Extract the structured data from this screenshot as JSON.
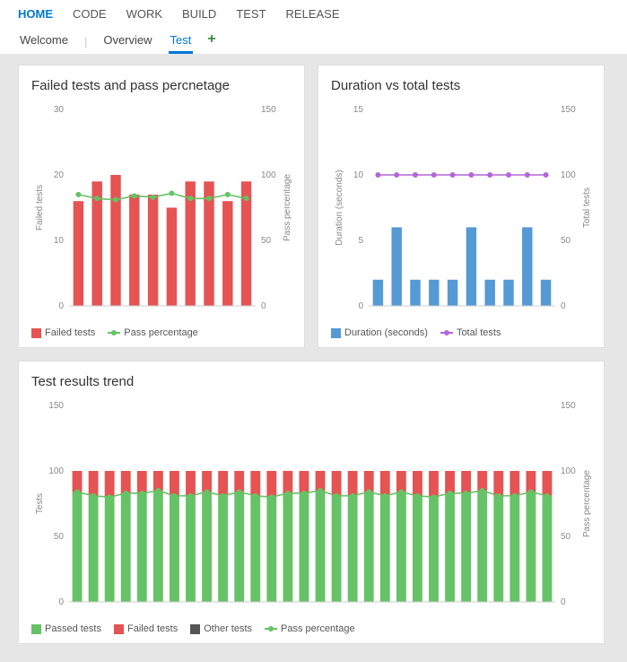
{
  "nav": {
    "main": [
      "HOME",
      "CODE",
      "WORK",
      "BUILD",
      "TEST",
      "RELEASE"
    ],
    "main_active": 0,
    "sub": [
      "Welcome",
      "Overview",
      "Test"
    ],
    "sub_active": 2
  },
  "colors": {
    "blue": "#0078d4",
    "red": "#e55353",
    "green": "#66c266",
    "purple": "#b366d9",
    "barBlue": "#5599d5",
    "grey": "#888888",
    "darkGrey": "#555555"
  },
  "chart_data": [
    {
      "id": "failed",
      "type": "bar+line",
      "title": "Failed tests and pass percnetage",
      "xcount": 10,
      "ylabel_left": "Failed tests",
      "ylabel_right": "Pass percentage",
      "ylim_left": [
        0,
        30
      ],
      "ylim_right": [
        0,
        150
      ],
      "ticks_left": [
        0,
        10,
        20,
        30
      ],
      "ticks_right": [
        0,
        50,
        100,
        150
      ],
      "series": [
        {
          "name": "Failed tests",
          "kind": "bar",
          "axis": "left",
          "color": "#e55353",
          "values": [
            16,
            19,
            20,
            17,
            17,
            15,
            19,
            19,
            16,
            19
          ]
        },
        {
          "name": "Pass percentage",
          "kind": "line",
          "axis": "right",
          "color": "#66c266",
          "values": [
            85,
            82,
            81,
            84,
            83,
            86,
            82,
            82,
            85,
            82
          ]
        }
      ],
      "legend": [
        {
          "swatch": "#e55353",
          "shape": "box",
          "label": "Failed tests"
        },
        {
          "swatch": "#66c266",
          "shape": "line",
          "label": "Pass percentage"
        }
      ]
    },
    {
      "id": "duration",
      "type": "bar+line",
      "title": "Duration vs total tests",
      "xcount": 10,
      "ylabel_left": "Duration (seconds)",
      "ylabel_right": "Total tests",
      "ylim_left": [
        0,
        15
      ],
      "ylim_right": [
        0,
        150
      ],
      "ticks_left": [
        0,
        5,
        10,
        15
      ],
      "ticks_right": [
        0,
        50,
        100,
        150
      ],
      "series": [
        {
          "name": "Duration (seconds)",
          "kind": "bar",
          "axis": "left",
          "color": "#5599d5",
          "values": [
            2,
            6,
            2,
            2,
            2,
            6,
            2,
            2,
            6,
            2
          ]
        },
        {
          "name": "Total tests",
          "kind": "line",
          "axis": "right",
          "color": "#b366d9",
          "values": [
            100,
            100,
            100,
            100,
            100,
            100,
            100,
            100,
            100,
            100
          ]
        }
      ],
      "legend": [
        {
          "swatch": "#5599d5",
          "shape": "box",
          "label": "Duration (seconds)"
        },
        {
          "swatch": "#b366d9",
          "shape": "line",
          "label": "Total tests"
        }
      ]
    },
    {
      "id": "trend",
      "type": "stacked+line",
      "title": "Test results trend",
      "xcount": 30,
      "ylabel_left": "Tests",
      "ylabel_right": "Pass percentage",
      "ylim_left": [
        0,
        150
      ],
      "ylim_right": [
        0,
        150
      ],
      "ticks_left": [
        0,
        50,
        100,
        150
      ],
      "ticks_right": [
        0,
        50,
        100,
        150
      ],
      "series": [
        {
          "name": "Passed tests",
          "kind": "bar",
          "axis": "left",
          "color": "#66c266",
          "values": [
            84,
            81,
            80,
            83,
            83,
            85,
            81,
            81,
            84,
            81,
            84,
            81,
            80,
            83,
            83,
            85,
            81,
            81,
            84,
            81,
            84,
            81,
            80,
            83,
            83,
            85,
            81,
            81,
            84,
            81
          ]
        },
        {
          "name": "Failed tests",
          "kind": "bar",
          "axis": "left",
          "color": "#e55353",
          "values": [
            16,
            19,
            20,
            17,
            17,
            15,
            19,
            19,
            16,
            19,
            16,
            19,
            20,
            17,
            17,
            15,
            19,
            19,
            16,
            19,
            16,
            19,
            20,
            17,
            17,
            15,
            19,
            19,
            16,
            19
          ]
        },
        {
          "name": "Other tests",
          "kind": "bar",
          "axis": "left",
          "color": "#555555",
          "values": [
            0,
            0,
            0,
            0,
            0,
            0,
            0,
            0,
            0,
            0,
            0,
            0,
            0,
            0,
            0,
            0,
            0,
            0,
            0,
            0,
            0,
            0,
            0,
            0,
            0,
            0,
            0,
            0,
            0,
            0
          ]
        },
        {
          "name": "Pass percentage",
          "kind": "line",
          "axis": "right",
          "color": "#66c266",
          "values": [
            84,
            81,
            80,
            83,
            83,
            85,
            81,
            81,
            84,
            81,
            84,
            81,
            80,
            83,
            83,
            85,
            81,
            81,
            84,
            81,
            84,
            81,
            80,
            83,
            83,
            85,
            81,
            81,
            84,
            81
          ]
        }
      ],
      "legend": [
        {
          "swatch": "#66c266",
          "shape": "box",
          "label": "Passed tests"
        },
        {
          "swatch": "#e55353",
          "shape": "box",
          "label": "Failed tests"
        },
        {
          "swatch": "#555555",
          "shape": "box",
          "label": "Other tests"
        },
        {
          "swatch": "#66c266",
          "shape": "line",
          "label": "Pass percentage"
        }
      ]
    }
  ]
}
